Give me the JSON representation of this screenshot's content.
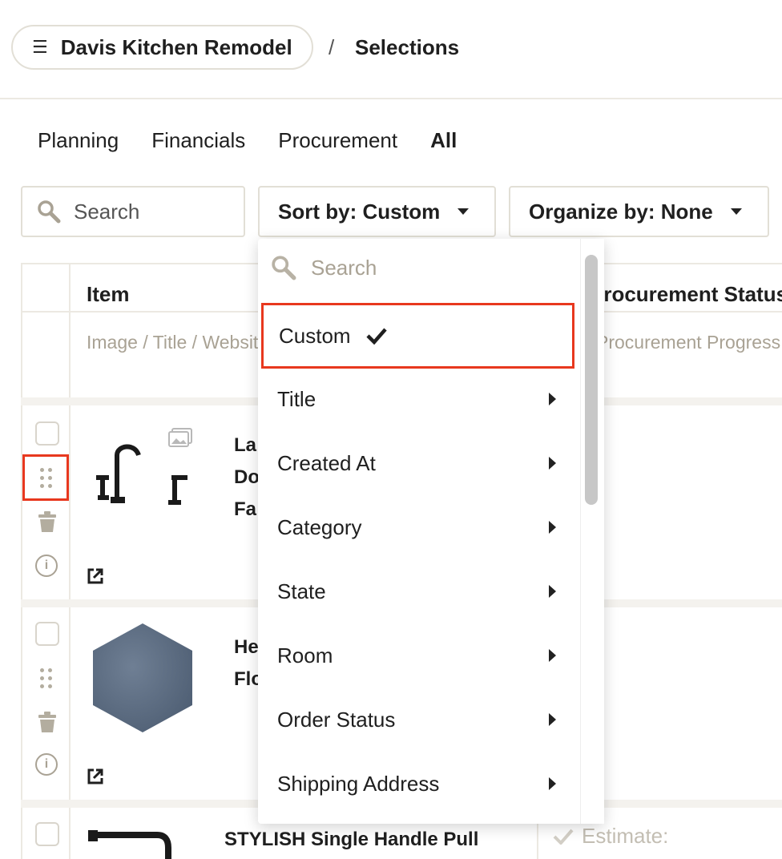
{
  "header": {
    "project_name": "Davis Kitchen Remodel",
    "separator": "/",
    "current_page": "Selections"
  },
  "tabs": [
    {
      "label": "Planning",
      "active": false
    },
    {
      "label": "Financials",
      "active": false
    },
    {
      "label": "Procurement",
      "active": false
    },
    {
      "label": "All",
      "active": true
    }
  ],
  "toolbar": {
    "search_placeholder": "Search",
    "sort_label": "Sort by: Custom",
    "organize_label": "Organize by: None"
  },
  "table": {
    "col_item_header": "Item",
    "col_item_sub": "Image / Title / Website",
    "col_status_header": "Procurement Status",
    "col_status_sub": "Procurement Progress",
    "rows": [
      {
        "title_lines": [
          "La",
          "Do",
          "Fa"
        ]
      },
      {
        "title_lines": [
          "He",
          "Flo"
        ]
      },
      {
        "title_lines": [
          "STYLISH Single Handle Pull"
        ],
        "status": "Estimate:"
      }
    ]
  },
  "sort_dropdown": {
    "search_placeholder": "Search",
    "options": [
      {
        "label": "Custom",
        "selected": true
      },
      {
        "label": "Title"
      },
      {
        "label": "Created At"
      },
      {
        "label": "Category"
      },
      {
        "label": "State"
      },
      {
        "label": "Room"
      },
      {
        "label": "Order Status"
      },
      {
        "label": "Shipping Address"
      }
    ]
  },
  "colors": {
    "highlight": "#e8381e",
    "border": "#e2dfd6",
    "muted_text": "#a9a294"
  },
  "icons": [
    "menu-icon",
    "search-icon",
    "caret-down-icon",
    "checkbox-icon",
    "drag-handle-icon",
    "trash-icon",
    "info-icon",
    "external-link-icon",
    "gallery-icon",
    "checkmark-icon",
    "chevron-right-icon"
  ]
}
